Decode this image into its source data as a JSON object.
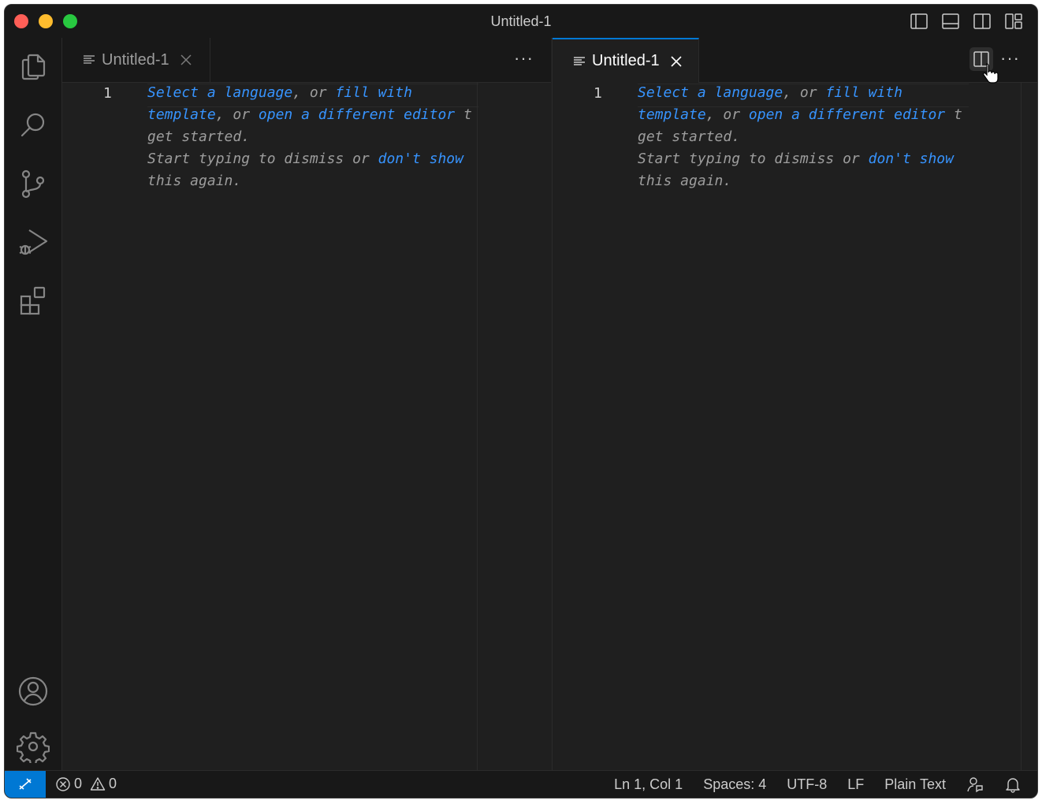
{
  "window": {
    "title": "Untitled-1"
  },
  "tabs": {
    "left": {
      "label": "Untitled-1",
      "more": "···"
    },
    "right": {
      "label": "Untitled-1",
      "more": "···"
    }
  },
  "editor": {
    "line_number": "1",
    "hint": {
      "p1": "Select a language",
      "p2": ", or ",
      "p3": "fill with",
      "p4": "template",
      "p5": ", or ",
      "p6": "open a different editor",
      "p7": " t",
      "p8": "get started.",
      "p9": "Start typing to dismiss or ",
      "p10": "don't show",
      "p11": "this again."
    }
  },
  "statusbar": {
    "errors": "0",
    "warnings": "0",
    "position": "Ln 1, Col 1",
    "spaces": "Spaces: 4",
    "encoding": "UTF-8",
    "eol": "LF",
    "language": "Plain Text"
  },
  "colors": {
    "accent": "#0078d4",
    "link": "#3794ff",
    "background": "#1f1f1f",
    "chrome": "#181818"
  }
}
